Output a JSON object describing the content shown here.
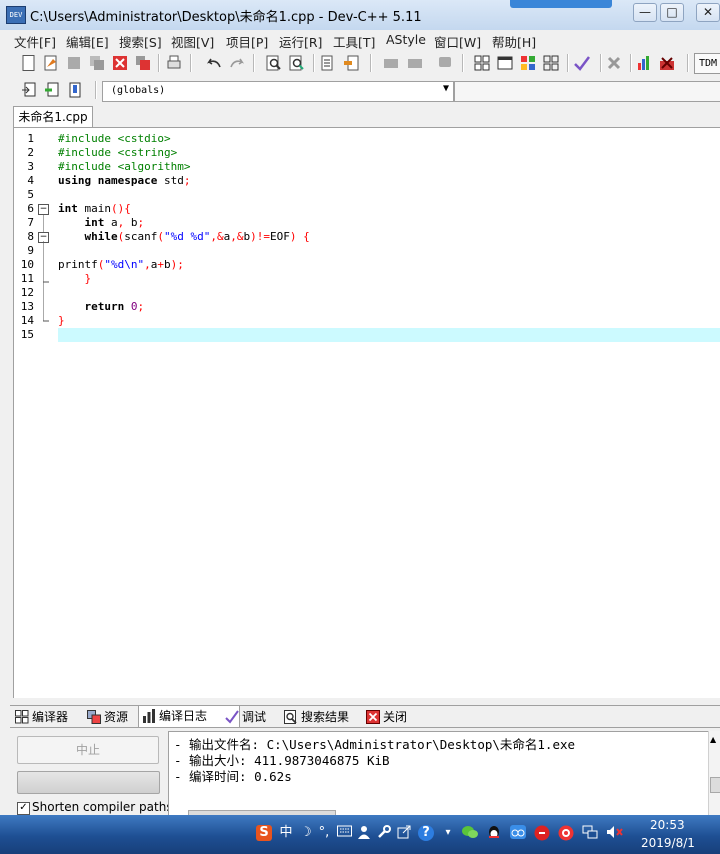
{
  "window": {
    "title": "C:\\Users\\Administrator\\Desktop\\未命名1.cpp - Dev-C++ 5.11",
    "icon_text": "DEV",
    "minimize_glyph": "—",
    "maximize_glyph": "□",
    "close_glyph": "✕"
  },
  "menu": [
    {
      "label": "文件[F]"
    },
    {
      "label": "编辑[E]"
    },
    {
      "label": "搜索[S]"
    },
    {
      "label": "视图[V]"
    },
    {
      "label": "项目[P]"
    },
    {
      "label": "运行[R]"
    },
    {
      "label": "工具[T]"
    },
    {
      "label": "AStyle"
    },
    {
      "label": "窗口[W]"
    },
    {
      "label": "帮助[H]"
    }
  ],
  "toolbar": {
    "tdm_label": "TDM",
    "scope_value": "(globals)",
    "dropdown_glyph": "▼"
  },
  "editor": {
    "tab_label": "未命名1.cpp",
    "line_numbers": [
      "1",
      "2",
      "3",
      "4",
      "5",
      "6",
      "7",
      "8",
      "9",
      "10",
      "11",
      "12",
      "13",
      "14",
      "15"
    ],
    "fold_minus": "−",
    "current_line": 15
  },
  "bottom_tabs": [
    {
      "label": "编译器"
    },
    {
      "label": "资源"
    },
    {
      "label": "编译日志"
    },
    {
      "label": "调试"
    },
    {
      "label": "搜索结果"
    },
    {
      "label": "关闭"
    }
  ],
  "panel": {
    "abort_label": "中止",
    "shorten_checked_glyph": "✓",
    "shorten_label": "Shorten compiler paths",
    "log_lines": [
      "- 输出文件名: C:\\Users\\Administrator\\Desktop\\未命名1.exe",
      "- 输出大小: 411.9873046875 KiB",
      "- 编译时间: 0.62s"
    ],
    "scroll_up_glyph": "▲"
  },
  "taskbar": {
    "ime_s": "S",
    "ime_zh": "中",
    "time": "20:53",
    "date": "2019/8/1"
  },
  "colors": {
    "preprocessor": "#008000",
    "keyword": "#000000",
    "string": "#0000ff",
    "number": "#800080",
    "symbol": "#ff0000",
    "current_line": "#ccfaff"
  }
}
